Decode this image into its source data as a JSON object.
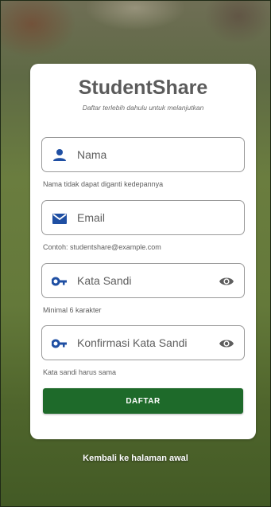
{
  "app": {
    "title": "StudentShare",
    "subtitle": "Daftar terlebih dahulu untuk melanjutkan"
  },
  "form": {
    "name": {
      "placeholder": "Nama",
      "helper": "Nama tidak dapat diganti kedepannya",
      "icon": "person-icon"
    },
    "email": {
      "placeholder": "Email",
      "helper": "Contoh: studentshare@example.com",
      "icon": "mail-icon"
    },
    "password": {
      "placeholder": "Kata Sandi",
      "helper": "Minimal 6 karakter",
      "icon": "key-icon",
      "toggle_icon": "eye-icon"
    },
    "confirm_password": {
      "placeholder": "Konfirmasi Kata Sandi",
      "helper": "Kata sandi harus sama",
      "icon": "key-icon",
      "toggle_icon": "eye-icon"
    },
    "submit_label": "DAFTAR"
  },
  "footer": {
    "back_link": "Kembali ke halaman awal"
  },
  "colors": {
    "icon_blue": "#1f4fa3",
    "button_green": "#1e6a2a",
    "text_gray": "#5e5e5e"
  }
}
